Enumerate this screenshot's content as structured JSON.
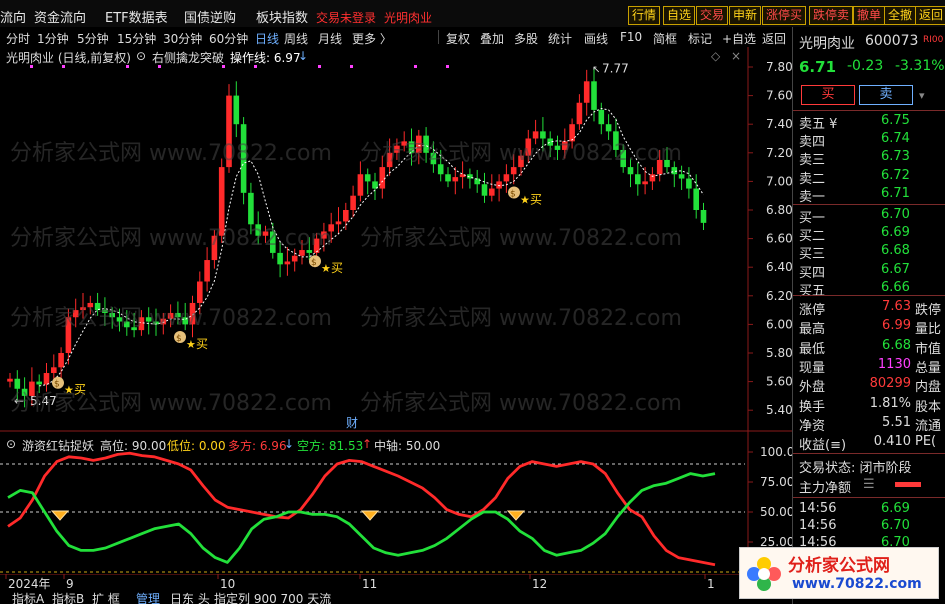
{
  "topmenu": {
    "items": [
      "流向",
      "资金流向",
      "ETF数据表",
      "国债逆购",
      "板块指数"
    ],
    "warn": "交易未登录",
    "stock_tag": "光明肉业",
    "buttons": [
      {
        "label": "行情",
        "color": "#ffd21a"
      },
      {
        "label": "自选",
        "color": "#ffd21a"
      },
      {
        "label": "交易",
        "color": "#ff4a4a"
      },
      {
        "label": "申新",
        "color": "#ffd21a"
      },
      {
        "label": "涨停买",
        "color": "#ff4a4a"
      },
      {
        "label": "跌停卖",
        "color": "#ff4a4a"
      },
      {
        "label": "撤单",
        "color": "#ff4a4a"
      },
      {
        "label": "全撤",
        "color": "#ffd21a"
      },
      {
        "label": "返回",
        "color": "#ffd21a"
      }
    ]
  },
  "toolbar": {
    "periods": [
      "分时",
      "1分钟",
      "5分钟",
      "15分钟",
      "30分钟",
      "60分钟",
      "日线",
      "周线",
      "月线",
      "更多 〉"
    ],
    "active": "日线",
    "tools": [
      "复权",
      "叠加",
      "多股",
      "统计",
      "画线",
      "F10",
      "简框",
      "标记",
      "+自选",
      "返回"
    ]
  },
  "chart_header": {
    "stock": "光明肉业 (日线,前复权)",
    "indicator": "右侧擒龙突破",
    "op_label": "操作线: 6.97",
    "op_arrow": "↓"
  },
  "price_axis": [
    "7.80",
    "7.60",
    "7.40",
    "7.20",
    "7.00",
    "6.80",
    "6.60",
    "6.40",
    "6.20",
    "6.00",
    "5.80",
    "5.60",
    "5.40"
  ],
  "annotations": {
    "high": "7.77",
    "low": "5.47",
    "buy": "买",
    "cai": "财"
  },
  "indicator_header": {
    "name": "游资红钻捉妖",
    "high_label": "高位: 90.00",
    "low_label": "低位: 0.00",
    "duo_label": "多方: 6.96",
    "duo_arrow": "↓",
    "kong_label": "空方: 81.53",
    "kong_arrow": "↑",
    "mid_label": "中轴: 50.00"
  },
  "ind_axis": [
    "100.0",
    "75.00",
    "50.00",
    "25.00"
  ],
  "xaxis": [
    "2024年",
    "9",
    "10",
    "11",
    "12",
    "1"
  ],
  "bottom_tabs": [
    "指标A",
    "指标B",
    "扩 框",
    "管理",
    "日东 头",
    "指定列 900 700 天流"
  ],
  "quote": {
    "name": "光明肉业",
    "code": "600073",
    "tag": "RI00",
    "price": "6.71",
    "change": "-0.23",
    "pct": "-3.31%",
    "buy_btn": "买",
    "sell_btn": "卖"
  },
  "orderbook": {
    "asks": [
      {
        "label": "卖五 ¥",
        "price": "6.75"
      },
      {
        "label": "卖四",
        "price": "6.74"
      },
      {
        "label": "卖三",
        "price": "6.73"
      },
      {
        "label": "卖二",
        "price": "6.72"
      },
      {
        "label": "卖一",
        "price": "6.71"
      }
    ],
    "bids": [
      {
        "label": "买一",
        "price": "6.70"
      },
      {
        "label": "买二",
        "price": "6.69"
      },
      {
        "label": "买三",
        "price": "6.68"
      },
      {
        "label": "买四",
        "price": "6.67"
      },
      {
        "label": "买五",
        "price": "6.66"
      }
    ]
  },
  "stats": [
    {
      "label": "涨停",
      "value": "7.63",
      "color": "#ff3a3a",
      "right": "跌停"
    },
    {
      "label": "最高",
      "value": "6.99",
      "color": "#ff3a3a",
      "right": "量比"
    },
    {
      "label": "最低",
      "value": "6.68",
      "color": "#22e03a",
      "right": "市值"
    },
    {
      "label": "现量",
      "value": "1130",
      "color": "#ff40ff",
      "right": "总量"
    },
    {
      "label": "外盘",
      "value": "80299",
      "color": "#ff3a3a",
      "right": "内盘"
    },
    {
      "label": "换手",
      "value": "1.81%",
      "color": "#dddddd",
      "right": "股本"
    },
    {
      "label": "净资",
      "value": "5.51",
      "color": "#dddddd",
      "right": "流通"
    },
    {
      "label": "收益(≡)",
      "value": "0.410",
      "color": "#dddddd",
      "right": "PE("
    }
  ],
  "trade_state": "交易状态: 闭市阶段",
  "main_force": "主力净额",
  "ticks": [
    {
      "time": "14:56",
      "price": "6.69"
    },
    {
      "time": "14:56",
      "price": "6.70"
    },
    {
      "time": "14:56",
      "price": "6.70"
    }
  ],
  "watermark": {
    "text": "分析家公式网 www.70822.com",
    "logo_text": "分析家公式网",
    "logo_url": "www.70822.com"
  },
  "colors": {
    "up": "#ff2a2a",
    "down": "#22e03a",
    "ma": "#ffffff",
    "accent": "#6fb0ff"
  }
}
